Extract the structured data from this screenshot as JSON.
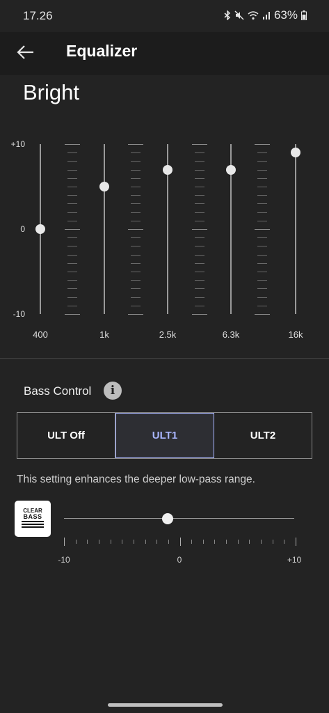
{
  "status": {
    "time": "17.26",
    "battery": "63%"
  },
  "header": {
    "title": "Equalizer",
    "back_icon": "arrow-left-icon"
  },
  "preset": "Bright",
  "eq": {
    "y_labels": {
      "max": "+10",
      "mid": "0",
      "min": "-10"
    },
    "range": [
      -10,
      10
    ],
    "bands": [
      {
        "label": "400",
        "value": 0
      },
      {
        "label": "1k",
        "value": 5
      },
      {
        "label": "2.5k",
        "value": 7
      },
      {
        "label": "6.3k",
        "value": 7
      },
      {
        "label": "16k",
        "value": 9
      }
    ]
  },
  "bass": {
    "title": "Bass Control",
    "info_icon": "info-icon",
    "options": [
      "ULT Off",
      "ULT1",
      "ULT2"
    ],
    "selected": "ULT1",
    "description": "This setting enhances the deeper low-pass range.",
    "clear_bass": {
      "logo_top": "CLEAR",
      "logo_bottom": "BASS",
      "value": -1,
      "range": [
        -10,
        10
      ],
      "labels": {
        "min": "-10",
        "mid": "0",
        "max": "+10"
      }
    }
  },
  "colors": {
    "accent": "#a9b6ff",
    "background": "#232323"
  }
}
